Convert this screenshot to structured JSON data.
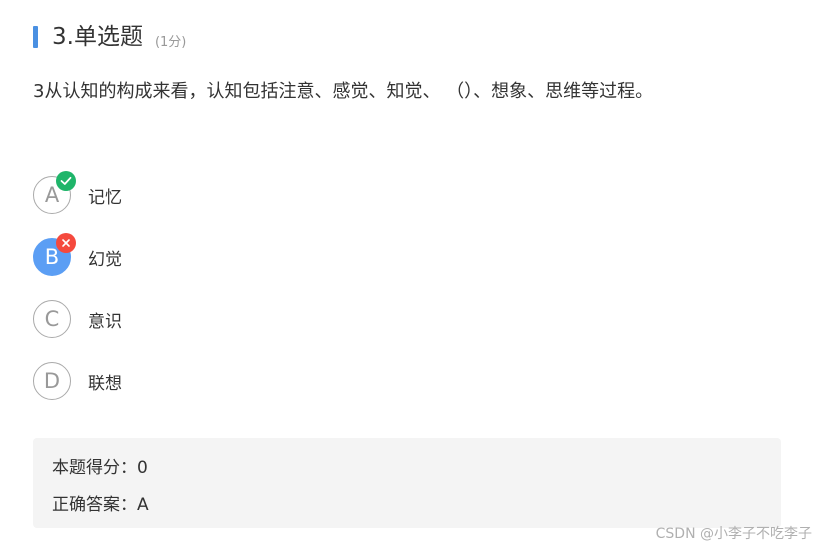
{
  "header": {
    "title": "3.单选题",
    "score": "(1分)"
  },
  "question": {
    "text": "3从认知的构成来看，认知包括注意、感觉、知觉、 （）、想象、思维等过程。"
  },
  "options": [
    {
      "letter": "A",
      "label": "记忆",
      "status": "correct"
    },
    {
      "letter": "B",
      "label": "幻觉",
      "status": "wrong-selected"
    },
    {
      "letter": "C",
      "label": "意识",
      "status": ""
    },
    {
      "letter": "D",
      "label": "联想",
      "status": ""
    }
  ],
  "result": {
    "score_line": "本题得分：0",
    "answer_line": "正确答案：A"
  },
  "watermark": "CSDN @小李子不吃李子",
  "colors": {
    "accent_blue": "#4a90e2",
    "selected_blue": "#5b9ef4",
    "correct_green": "#1fb56a",
    "wrong_red": "#f5493d"
  }
}
